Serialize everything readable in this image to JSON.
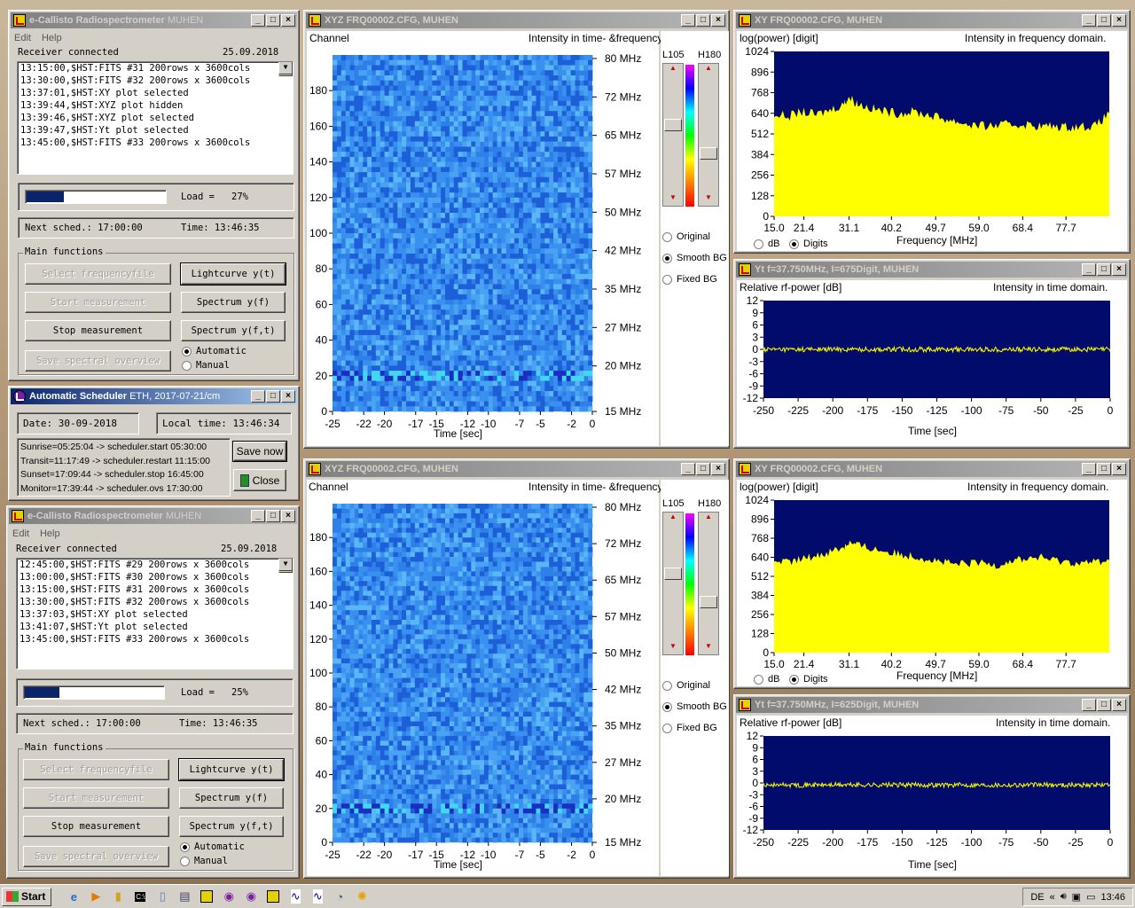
{
  "desktop": {
    "background": "#b79d7b"
  },
  "main_top": {
    "title": "e-Callisto Radiospectrometer",
    "title_sub": "MUHEN",
    "menu": [
      "Edit",
      "Help"
    ],
    "status": "Receiver connected",
    "date": "25.09.2018",
    "log": [
      "13:15:00,$HST:FITS #31 200rows x 3600cols",
      "13:30:00,$HST:FITS #32 200rows x 3600cols",
      "13:37:01,$HST:XY plot selected",
      "13:39:44,$HST:XYZ plot hidden",
      "13:39:46,$HST:XYZ plot selected",
      "13:39:47,$HST:Yt plot selected",
      "13:45:00,$HST:FITS #33 200rows x 3600cols"
    ],
    "load_label": "Load =",
    "load_value": "27%",
    "load_fraction": 0.27,
    "next_sched": "Next sched.: 17:00:00",
    "time": "Time: 13:46:35",
    "group_label": "Main functions",
    "buttons": {
      "select": "Select frequencyfile",
      "lightcurve": "Lightcurve y(t)",
      "start": "Start measurement",
      "spectrum_f": "Spectrum y(f)",
      "stop": "Stop measurement",
      "spectrum_ft": "Spectrum y(f,t)",
      "save": "Save spectral overview"
    },
    "radio_auto": "Automatic",
    "radio_manual": "Manual"
  },
  "scheduler": {
    "title": "Automatic Scheduler",
    "title_sub": "ETH, 2017-07-21/cm",
    "date": "Date: 30-09-2018",
    "local_time": "Local time: 13:46:34",
    "lines": [
      "Sunrise=05:25:04 -> scheduler.start 05:30:00",
      "Transit=11:17:49 -> scheduler.restart 11:15:00",
      "Sunset=17:09:44 -> scheduler.stop 16:45:00",
      "Monitor=17:39:44 -> scheduler.ovs 17:30:00"
    ],
    "save_now": "Save now",
    "close": "Close"
  },
  "main_bottom": {
    "title": "e-Callisto Radiospectrometer",
    "title_sub": "MUHEN",
    "menu": [
      "Edit",
      "Help"
    ],
    "status": "Receiver connected",
    "date": "25.09.2018",
    "log": [
      "12:45:00,$HST:FITS #29 200rows x 3600cols",
      "13:00:00,$HST:FITS #30 200rows x 3600cols",
      "13:15:00,$HST:FITS #31 200rows x 3600cols",
      "13:30:00,$HST:FITS #32 200rows x 3600cols",
      "13:37:03,$HST:XY plot selected",
      "13:41:07,$HST:Yt plot selected",
      "13:45:00,$HST:FITS #33 200rows x 3600cols"
    ],
    "load_label": "Load =",
    "load_value": "25%",
    "load_fraction": 0.25,
    "next_sched": "Next sched.: 17:00:00",
    "time": "Time: 13:46:35",
    "group_label": "Main functions",
    "buttons": {
      "select": "Select frequencyfile",
      "lightcurve": "Lightcurve y(t)",
      "start": "Start measurement",
      "spectrum_f": "Spectrum y(f)",
      "stop": "Stop measurement",
      "spectrum_ft": "Spectrum y(f,t)",
      "save": "Save spectral overview"
    },
    "radio_auto": "Automatic",
    "radio_manual": "Manual"
  },
  "xyz_top": {
    "title": "XYZ  FRQ00002.CFG, MUHEN",
    "ylabel": "Channel",
    "subtitle": "Intensity in time- &frequency domain.",
    "xlabel": "Time [sec]",
    "low": "L105",
    "high": "H180",
    "radios": [
      "Original",
      "Smooth BG",
      "Fixed BG"
    ],
    "selected": 1
  },
  "xyz_bottom": {
    "title": "XYZ  FRQ00002.CFG, MUHEN",
    "ylabel": "Channel",
    "subtitle": "Intensity in time- &frequency domain.",
    "xlabel": "Time [sec]",
    "low": "L105",
    "high": "H180",
    "radios": [
      "Original",
      "Smooth BG",
      "Fixed BG"
    ],
    "selected": 1
  },
  "xy_top": {
    "title": "XY  FRQ00002.CFG, MUHEN",
    "ylabel": "log(power) [digit]",
    "subtitle": "Intensity in frequency domain.",
    "xlabel": "Frequency [MHz]",
    "opt_db": "dB",
    "opt_digits": "Digits"
  },
  "xy_bottom": {
    "title": "XY  FRQ00002.CFG, MUHEN",
    "ylabel": "log(power) [digit]",
    "subtitle": "Intensity in frequency domain.",
    "xlabel": "Frequency [MHz]",
    "opt_db": "dB",
    "opt_digits": "Digits"
  },
  "yt_top": {
    "title": "Yt  f=37.750MHz, I=675Digit, MUHEN",
    "ylabel": "Relative rf-power [dB]",
    "subtitle": "Intensity in time domain.",
    "xlabel": "Time [sec]"
  },
  "yt_bottom": {
    "title": "Yt  f=37.750MHz, I=625Digit, MUHEN",
    "ylabel": "Relative rf-power [dB]",
    "subtitle": "Intensity in time domain.",
    "xlabel": "Time [sec]"
  },
  "chart_data": [
    {
      "type": "heatmap",
      "x_ticks": [
        "-25",
        "-22",
        "-20",
        "-17",
        "-15",
        "-12",
        "-10",
        "-7",
        "-5",
        "-2",
        "0"
      ],
      "y_ticks": [
        "0",
        "20",
        "40",
        "60",
        "80",
        "100",
        "120",
        "140",
        "160",
        "180"
      ],
      "freq_ticks": [
        "15 MHz",
        "20 MHz",
        "27 MHz",
        "35 MHz",
        "42 MHz",
        "50 MHz",
        "57 MHz",
        "65 MHz",
        "72 MHz",
        "80 MHz"
      ],
      "xlim": [
        -25,
        0
      ],
      "ylim": [
        0,
        200
      ]
    },
    {
      "type": "heatmap",
      "x_ticks": [
        "-25",
        "-22",
        "-20",
        "-17",
        "-15",
        "-12",
        "-10",
        "-7",
        "-5",
        "-2",
        "0"
      ],
      "y_ticks": [
        "0",
        "20",
        "40",
        "60",
        "80",
        "100",
        "120",
        "140",
        "160",
        "180"
      ],
      "freq_ticks": [
        "15 MHz",
        "20 MHz",
        "27 MHz",
        "35 MHz",
        "42 MHz",
        "50 MHz",
        "57 MHz",
        "65 MHz",
        "72 MHz",
        "80 MHz"
      ],
      "xlim": [
        -25,
        0
      ],
      "ylim": [
        0,
        200
      ]
    },
    {
      "type": "area",
      "x_ticks": [
        "15.0",
        "21.4",
        "31.1",
        "40.2",
        "49.7",
        "59.0",
        "68.4",
        "77.7"
      ],
      "y_ticks": [
        "0",
        "128",
        "256",
        "384",
        "512",
        "640",
        "768",
        "896",
        "1024"
      ],
      "xlim": [
        15,
        87
      ],
      "ylim": [
        0,
        1024
      ],
      "x": [
        15,
        18,
        21,
        24,
        27,
        30,
        31,
        33,
        36,
        39,
        42,
        45,
        48,
        51,
        54,
        57,
        60,
        63,
        66,
        69,
        72,
        75,
        78,
        81,
        84,
        87
      ],
      "values": [
        640,
        620,
        650,
        630,
        660,
        700,
        740,
        700,
        670,
        650,
        640,
        650,
        630,
        610,
        590,
        570,
        560,
        565,
        570,
        570,
        560,
        560,
        555,
        560,
        560,
        640
      ],
      "bar_color": "#ffff00",
      "bg": "#000b6b"
    },
    {
      "type": "area",
      "x_ticks": [
        "15.0",
        "21.4",
        "31.1",
        "40.2",
        "49.7",
        "59.0",
        "68.4",
        "77.7"
      ],
      "y_ticks": [
        "0",
        "128",
        "256",
        "384",
        "512",
        "640",
        "768",
        "896",
        "1024"
      ],
      "xlim": [
        15,
        87
      ],
      "ylim": [
        0,
        1024
      ],
      "x": [
        15,
        18,
        21,
        24,
        27,
        30,
        31,
        33,
        36,
        39,
        42,
        45,
        48,
        51,
        54,
        57,
        60,
        63,
        66,
        69,
        72,
        75,
        78,
        81,
        84,
        87
      ],
      "values": [
        620,
        600,
        630,
        650,
        680,
        710,
        740,
        720,
        700,
        680,
        660,
        650,
        630,
        610,
        590,
        600,
        600,
        590,
        620,
        630,
        640,
        620,
        610,
        600,
        610,
        620
      ],
      "bar_color": "#ffff00",
      "bg": "#000b6b"
    },
    {
      "type": "line",
      "x_ticks": [
        "-250",
        "-225",
        "-200",
        "-175",
        "-150",
        "-125",
        "-100",
        "-75",
        "-50",
        "-25",
        "0"
      ],
      "y_ticks": [
        "12",
        "9",
        "6",
        "3",
        "0",
        "-3",
        "-6",
        "-9",
        "-12"
      ],
      "xlim": [
        -250,
        0
      ],
      "ylim": [
        -12,
        12
      ],
      "level": 0,
      "line_color": "#ffff00",
      "bg": "#000b6b"
    },
    {
      "type": "line",
      "x_ticks": [
        "-250",
        "-225",
        "-200",
        "-175",
        "-150",
        "-125",
        "-100",
        "-75",
        "-50",
        "-25",
        "0"
      ],
      "y_ticks": [
        "12",
        "9",
        "6",
        "3",
        "0",
        "-3",
        "-6",
        "-9",
        "-12"
      ],
      "xlim": [
        -250,
        0
      ],
      "ylim": [
        -12,
        12
      ],
      "level": -0.5,
      "line_color": "#ffff00",
      "bg": "#000b6b"
    }
  ],
  "taskbar": {
    "start": "Start",
    "lang": "DE",
    "clock": "13:46"
  }
}
